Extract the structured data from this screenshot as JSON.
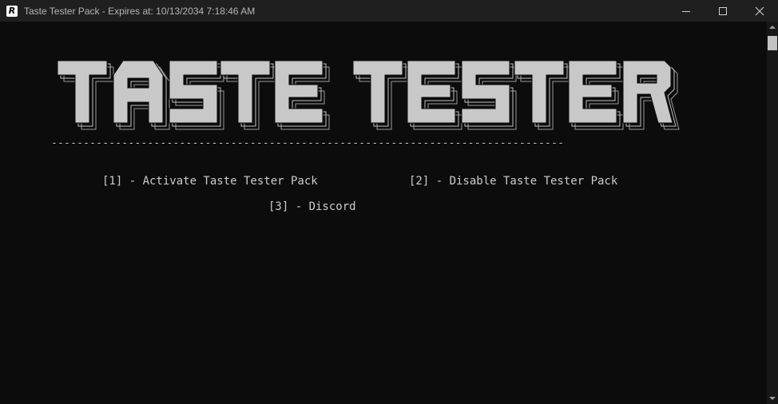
{
  "window": {
    "title": "Taste Tester Pack - Expires at: 10/13/2034 7:18:46 AM",
    "app_icon_letter": "R",
    "controls": [
      "minimize-icon",
      "maximize-icon",
      "close-icon"
    ]
  },
  "console": {
    "banner": "TASTE TESTER",
    "divider": "--------------------------------------------------------------------------------",
    "options": [
      "[1] - Activate Taste Tester Pack",
      "[2] - Disable Taste Tester Pack",
      "[3] - Discord"
    ]
  },
  "colors": {
    "background": "#0c0c0c",
    "titlebar": "#1f1f1f",
    "text": "#cccccc",
    "banner_fill": "#c8c8c8"
  }
}
